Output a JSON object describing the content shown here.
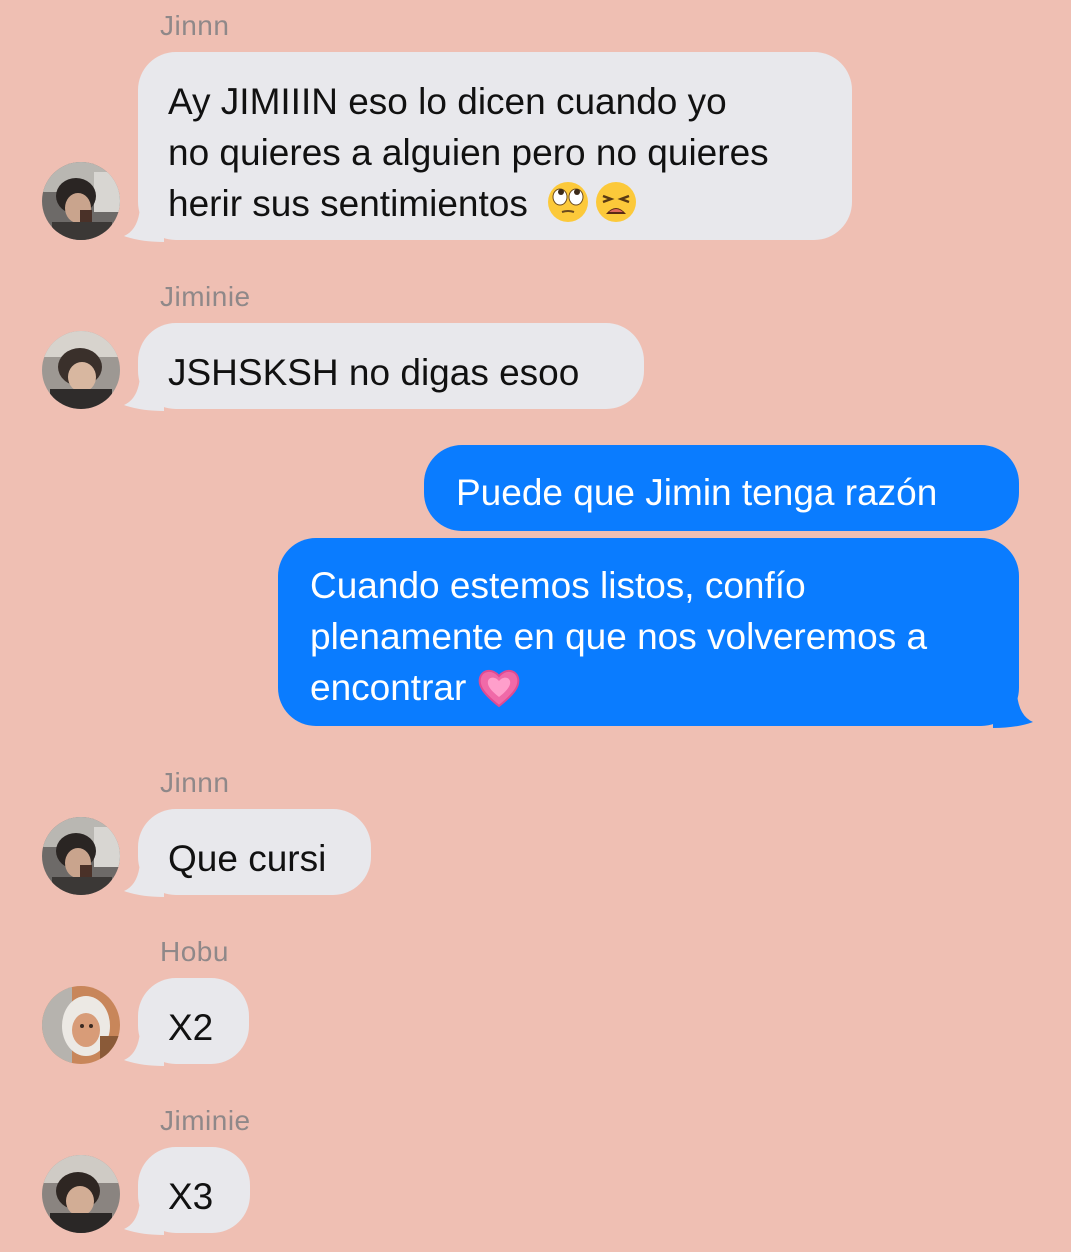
{
  "messages": [
    {
      "sender": "Jinnn",
      "lines": [
        "Ay JIMIIIN eso lo dicen cuando yo",
        "no quieres a alguien pero no quieres",
        "herir sus sentimientos"
      ],
      "emojis": [
        "face-with-rolling-eyes",
        "weary-face"
      ]
    },
    {
      "sender": "Jiminie",
      "lines": [
        "JSHSKSH no digas esoo"
      ]
    },
    {
      "sender": "",
      "lines": [
        "Puede que Jimin tenga razón"
      ]
    },
    {
      "sender": "",
      "lines": [
        "Cuando estemos listos, confío",
        "plenamente en que nos volveremos a",
        "encontrar"
      ],
      "emojis": [
        "growing-heart"
      ]
    },
    {
      "sender": "Jinnn",
      "lines": [
        "Que cursi"
      ]
    },
    {
      "sender": "Hobu",
      "lines": [
        "X2"
      ]
    },
    {
      "sender": "Jiminie",
      "lines": [
        "X3"
      ]
    }
  ],
  "colors": {
    "background": "#efbfb3",
    "incoming_bubble": "#e8e8ec",
    "outgoing_bubble": "#0a7cff",
    "sender_name": "#8f8889"
  }
}
